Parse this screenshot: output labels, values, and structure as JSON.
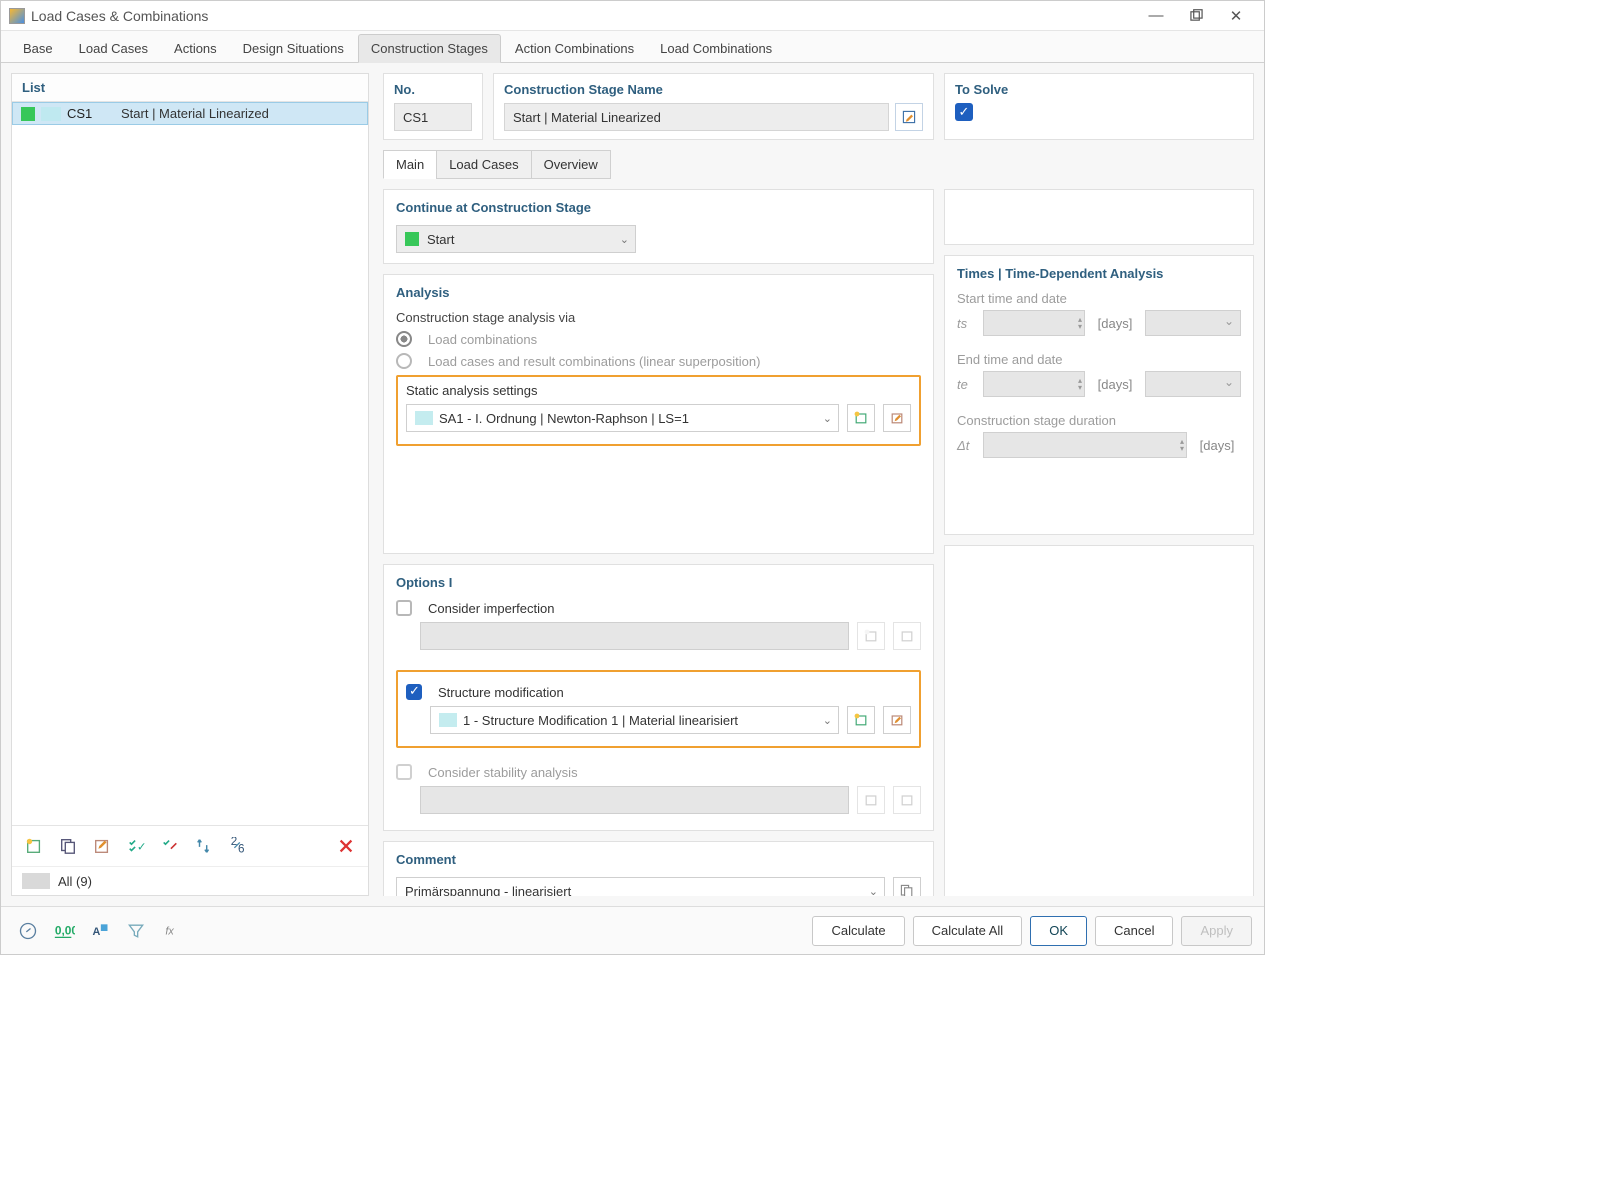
{
  "window": {
    "title": "Load Cases & Combinations"
  },
  "tabs": {
    "items": [
      "Base",
      "Load Cases",
      "Actions",
      "Design Situations",
      "Construction Stages",
      "Action Combinations",
      "Load Combinations"
    ],
    "active_index": 4
  },
  "left": {
    "title": "List",
    "items": [
      {
        "code": "CS1",
        "label": "Start | Material Linearized"
      }
    ],
    "filter_label": "All (9)"
  },
  "header_fields": {
    "no_label": "No.",
    "no_value": "CS1",
    "name_label": "Construction Stage Name",
    "name_value": "Start | Material Linearized",
    "to_solve_label": "To Solve",
    "to_solve": true
  },
  "inner_tabs": {
    "items": [
      "Main",
      "Load Cases",
      "Overview"
    ],
    "active_index": 0
  },
  "continue_section": {
    "title": "Continue at Construction Stage",
    "value": "Start"
  },
  "analysis": {
    "title": "Analysis",
    "via_label": "Construction stage analysis via",
    "via_options": {
      "load_combinations": "Load combinations",
      "linear_superposition": "Load cases and result combinations (linear superposition)"
    },
    "static_label": "Static analysis settings",
    "static_value": "SA1 - I. Ordnung | Newton-Raphson | LS=1"
  },
  "times": {
    "title": "Times | Time-Dependent Analysis",
    "start_label": "Start time and date",
    "end_label": "End time and date",
    "duration_label": "Construction stage duration",
    "ts": "ts",
    "te": "te",
    "dt": "Δt",
    "unit": "[days]"
  },
  "options": {
    "title": "Options I",
    "imperfection_label": "Consider imperfection",
    "imperfection_checked": false,
    "structure_label": "Structure modification",
    "structure_checked": true,
    "structure_value": "1 - Structure Modification 1 | Material linearisiert",
    "stability_label": "Consider stability analysis",
    "stability_checked": false
  },
  "comment": {
    "title": "Comment",
    "value": "Primärspannung - linearisiert"
  },
  "footer": {
    "calculate": "Calculate",
    "calculate_all": "Calculate All",
    "ok": "OK",
    "cancel": "Cancel",
    "apply": "Apply"
  }
}
